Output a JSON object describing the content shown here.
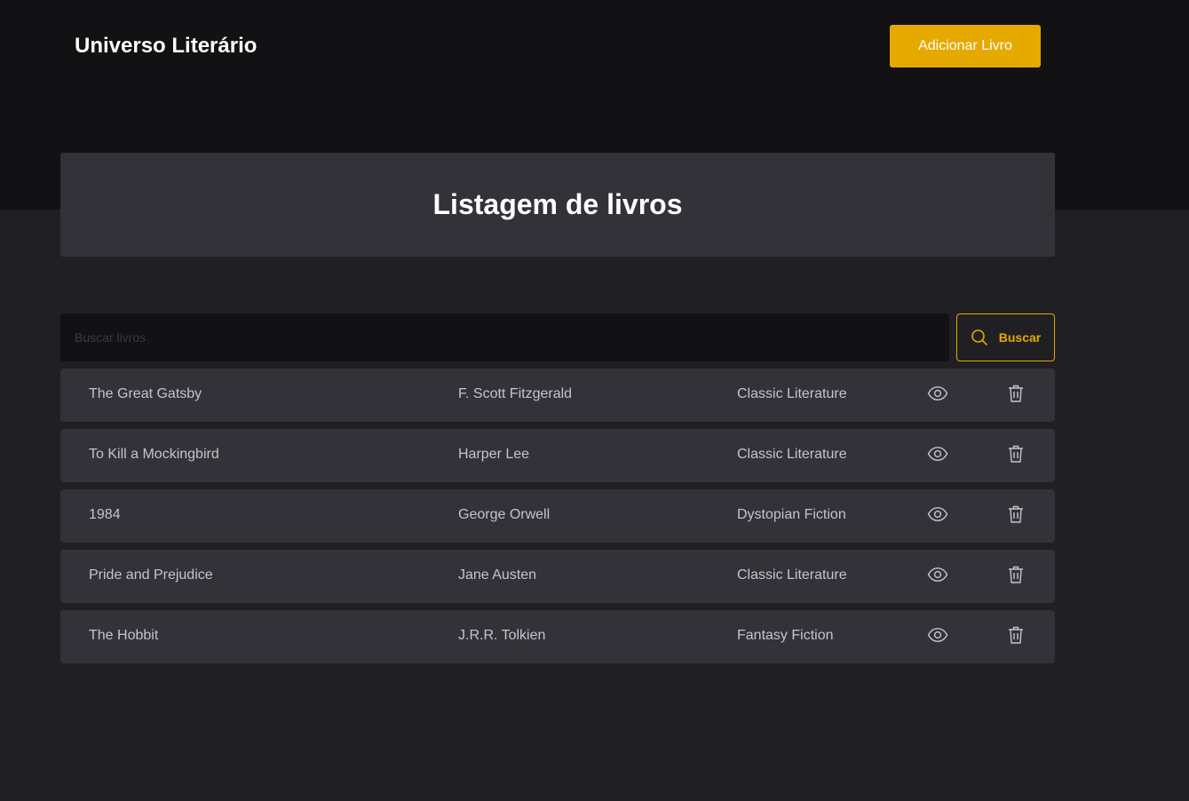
{
  "header": {
    "brand": "Universo Literário",
    "add_button_label": "Adicionar Livro"
  },
  "main": {
    "title": "Listagem de livros"
  },
  "search": {
    "placeholder": "Buscar livros",
    "value": "",
    "button_label": "Buscar"
  },
  "books": [
    {
      "title": "The Great Gatsby",
      "author": "F. Scott Fitzgerald",
      "genre": "Classic Literature"
    },
    {
      "title": "To Kill a Mockingbird",
      "author": "Harper Lee",
      "genre": "Classic Literature"
    },
    {
      "title": "1984",
      "author": "George Orwell",
      "genre": "Dystopian Fiction"
    },
    {
      "title": "Pride and Prejudice",
      "author": "Jane Austen",
      "genre": "Classic Literature"
    },
    {
      "title": "The Hobbit",
      "author": "J.R.R. Tolkien",
      "genre": "Fantasy Fiction"
    }
  ],
  "icons": {
    "search": "search-icon",
    "view": "eye-icon",
    "delete": "trash-icon"
  },
  "colors": {
    "accent": "#e5a900",
    "header_bg": "#121214",
    "page_bg": "#202024",
    "card_bg": "#323238",
    "text": "#c4c4cc"
  }
}
